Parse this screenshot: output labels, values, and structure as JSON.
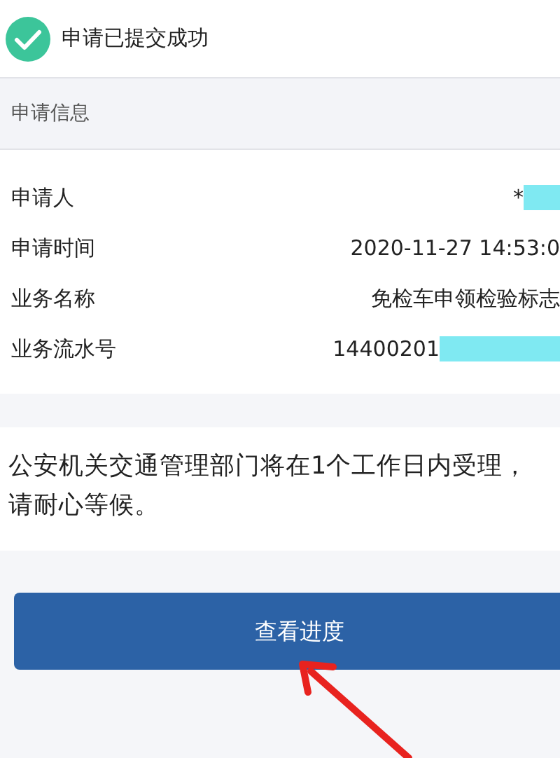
{
  "status": {
    "title": "申请已提交成功"
  },
  "section": {
    "title": "申请信息"
  },
  "rows": [
    {
      "label": "申请人",
      "value": "*",
      "redacted": true
    },
    {
      "label": "申请时间",
      "value": "2020-11-27 14:53:0",
      "redacted": false
    },
    {
      "label": "业务名称",
      "value": "免检车申领检验标志",
      "redacted": false
    },
    {
      "label": "业务流水号",
      "value": "14400201",
      "redacted": true
    }
  ],
  "notice": "公安机关交通管理部门将在1个工作日内受理，请耐心等候。",
  "button": {
    "label": "查看进度"
  }
}
